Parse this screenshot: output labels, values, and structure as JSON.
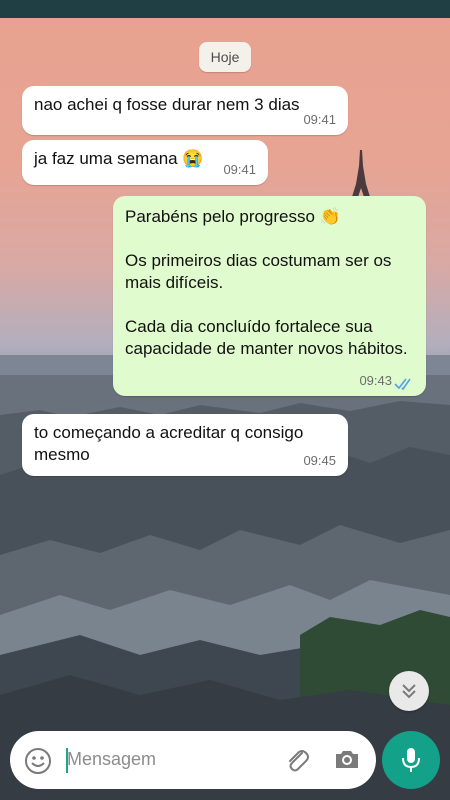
{
  "conversation": {
    "date_label": "Hoje",
    "messages": [
      {
        "direction": "in",
        "text": "nao achei q fosse durar nem 3 dias",
        "time": "09:41"
      },
      {
        "direction": "in",
        "text": "ja faz uma semana 😭",
        "time": "09:41"
      },
      {
        "direction": "out",
        "text": "Parabéns pelo progresso 👏\n\nOs primeiros dias costumam ser os\nmais difíceis.\n\nCada dia concluído fortalece sua\ncapacidade de manter novos hábitos.",
        "time": "09:43",
        "status": "read"
      },
      {
        "direction": "in",
        "text": "to começando a acreditar q consigo\nmesmo",
        "time": "09:45"
      }
    ]
  },
  "composer": {
    "placeholder": "Mensagem",
    "icons": [
      "emoji-icon",
      "paperclip-icon",
      "camera-icon",
      "microphone-icon"
    ]
  },
  "scroll_button": {
    "icon": "double-chevron-down-icon"
  },
  "colors": {
    "incoming_bubble": "#ffffff",
    "outgoing_bubble": "#e0fbcd",
    "accent": "#13a18a",
    "read_ticks": "#4fa3e6"
  }
}
